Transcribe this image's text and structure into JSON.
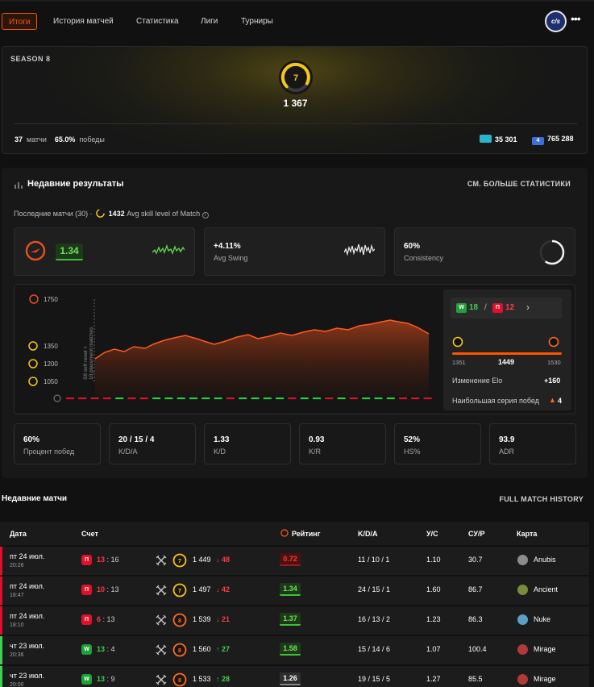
{
  "nav": {
    "tabs": [
      {
        "label": "Итоги",
        "active": true
      },
      {
        "label": "История матчей",
        "active": false
      },
      {
        "label": "Статистика",
        "active": false
      },
      {
        "label": "Лиги",
        "active": false
      },
      {
        "label": "Турниры",
        "active": false
      }
    ],
    "avatar_text": "c/s",
    "more": "•••"
  },
  "season": {
    "title": "SEASON 8",
    "level": "7",
    "elo": "1 367",
    "matches_value": "37",
    "matches_label": "матчи",
    "winrate_value": "65.0%",
    "winrate_label": "победы",
    "country_rank": "35 301",
    "region_rank": "765 288",
    "colors": {
      "accent": "#ff5500",
      "level": "#f5c518"
    }
  },
  "results": {
    "title": "Недавние результаты",
    "more_link": "СМ. БОЛЬШЕ СТАТИСТИКИ",
    "last_matches_label": "Последние матчи (30) ·",
    "skill_avg": "1432",
    "skill_avg_label": "Avg skill level of Match",
    "rating_card": {
      "value": "1.34"
    },
    "swing_card": {
      "value": "+4.11%",
      "label": "Avg Swing"
    },
    "consistency_card": {
      "value": "60%",
      "label": "Consistency",
      "fraction": 0.6
    },
    "chart": {
      "ticks": [
        "1750",
        "1350",
        "1200",
        "1050"
      ],
      "rotated_note_1": "S8 soft reset +",
      "rotated_note_2": "10 placement matches"
    },
    "summary": {
      "wins": "18",
      "losses": "12",
      "win_letter": "W",
      "loss_letter": "П",
      "sep": "/",
      "elo_low": "1351",
      "elo_now": "1449",
      "elo_high": "1530",
      "elo_change_label": "Изменение Elo",
      "elo_change_value": "+160",
      "streak_label": "Наибольшая серия побед",
      "streak_value": "4"
    },
    "stats": [
      {
        "value": "60%",
        "label": "Процент побед"
      },
      {
        "value": "20 / 15 / 4",
        "label": "K/D/A"
      },
      {
        "value": "1.33",
        "label": "K/D"
      },
      {
        "value": "0.93",
        "label": "K/R"
      },
      {
        "value": "52%",
        "label": "HS%"
      },
      {
        "value": "93.9",
        "label": "ADR"
      }
    ]
  },
  "matches": {
    "title": "Недавние матчи",
    "more_link": "FULL MATCH HISTORY",
    "headers": {
      "date": "Дата",
      "score": "Счет",
      "rating": "Рейтинг",
      "kda": "K/D/A",
      "kr": "У/С",
      "adr": "СУ/Р",
      "map": "Карта"
    },
    "rows": [
      {
        "date": "пт 24 июл.",
        "time": "20:26",
        "result": "П",
        "win": false,
        "s1": "13",
        "s2": "16",
        "level": "7",
        "elo": "1 449",
        "delta": "48",
        "up": false,
        "rating": "0.72",
        "rq": "bad",
        "kda": "11 / 10 / 1",
        "kr": "1.10",
        "adr": "30.7",
        "map": "Anubis"
      },
      {
        "date": "пт 24 июл.",
        "time": "18:47",
        "result": "П",
        "win": false,
        "s1": "10",
        "s2": "13",
        "level": "7",
        "elo": "1 497",
        "delta": "42",
        "up": false,
        "rating": "1.34",
        "rq": "good",
        "kda": "24 / 15 / 1",
        "kr": "1.60",
        "adr": "86.7",
        "map": "Ancient"
      },
      {
        "date": "пт 24 июл.",
        "time": "18:10",
        "result": "П",
        "win": false,
        "s1": "6",
        "s2": "13",
        "level": "8",
        "elo": "1 539",
        "delta": "21",
        "up": false,
        "rating": "1.37",
        "rq": "good",
        "kda": "16 / 13 / 2",
        "kr": "1.23",
        "adr": "86.3",
        "map": "Nuke"
      },
      {
        "date": "чт 23 июл.",
        "time": "20:36",
        "result": "W",
        "win": true,
        "s1": "13",
        "s2": "4",
        "level": "8",
        "elo": "1 560",
        "delta": "27",
        "up": true,
        "rating": "1.58",
        "rq": "good",
        "kda": "15 / 14 / 6",
        "kr": "1.07",
        "adr": "100.4",
        "map": "Mirage"
      },
      {
        "date": "чт 23 июл.",
        "time": "20:00",
        "result": "W",
        "win": true,
        "s1": "13",
        "s2": "9",
        "level": "8",
        "elo": "1 533",
        "delta": "28",
        "up": true,
        "rating": "1.26",
        "rq": "mid",
        "kda": "19 / 15 / 5",
        "kr": "1.27",
        "adr": "85.5",
        "map": "Mirage"
      }
    ]
  }
}
